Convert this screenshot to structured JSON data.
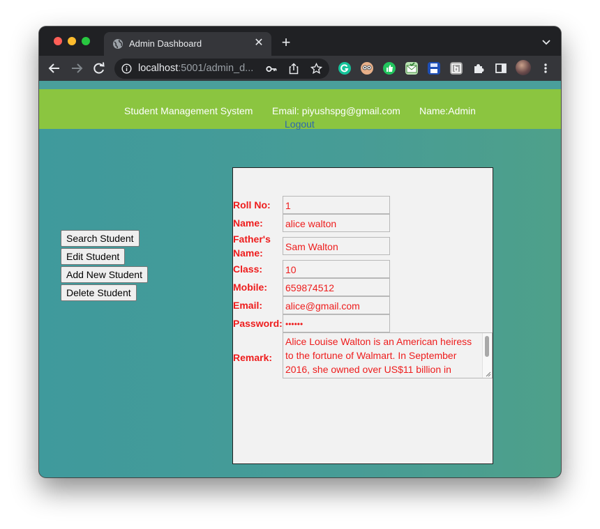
{
  "browser": {
    "tab_title": "Admin Dashboard",
    "url_host": "localhost",
    "url_rest": ":5001/admin_d..."
  },
  "header": {
    "title": "Student Management System",
    "email": "Email: piyushspg@gmail.com",
    "name": "Name:Admin",
    "logout": "Logout"
  },
  "sidebar": {
    "buttons": [
      "Search Student",
      "Edit Student",
      "Add New Student",
      "Delete Student"
    ]
  },
  "form": {
    "labels": {
      "roll": "Roll No:",
      "name": "Name:",
      "father_line1": "Father's",
      "father_line2": "Name:",
      "class": "Class:",
      "mobile": "Mobile:",
      "email": "Email:",
      "password": "Password:",
      "remark": "Remark:"
    },
    "values": {
      "roll": "1",
      "name": "alice walton",
      "father": "Sam Walton",
      "class": "10",
      "mobile": "659874512",
      "email": "alice@gmail.com",
      "password": "••••••",
      "remark": "Alice Louise Walton is an American heiress to the fortune of Walmart. In September 2016, she owned over US$11 billion in"
    }
  },
  "colors": {
    "header_bg": "#8bc540",
    "page_bg": "#479c96",
    "form_text": "#ee1c1c",
    "link": "#2a66b3"
  },
  "icons": [
    "globe-icon",
    "close-icon",
    "plus-icon",
    "chevron-down-icon",
    "back-icon",
    "forward-icon",
    "reload-icon",
    "info-icon",
    "key-icon",
    "share-icon",
    "star-icon",
    "grammarly-icon",
    "extension-icons",
    "puzzle-icon",
    "sidepanel-icon",
    "avatar",
    "more-icon"
  ]
}
